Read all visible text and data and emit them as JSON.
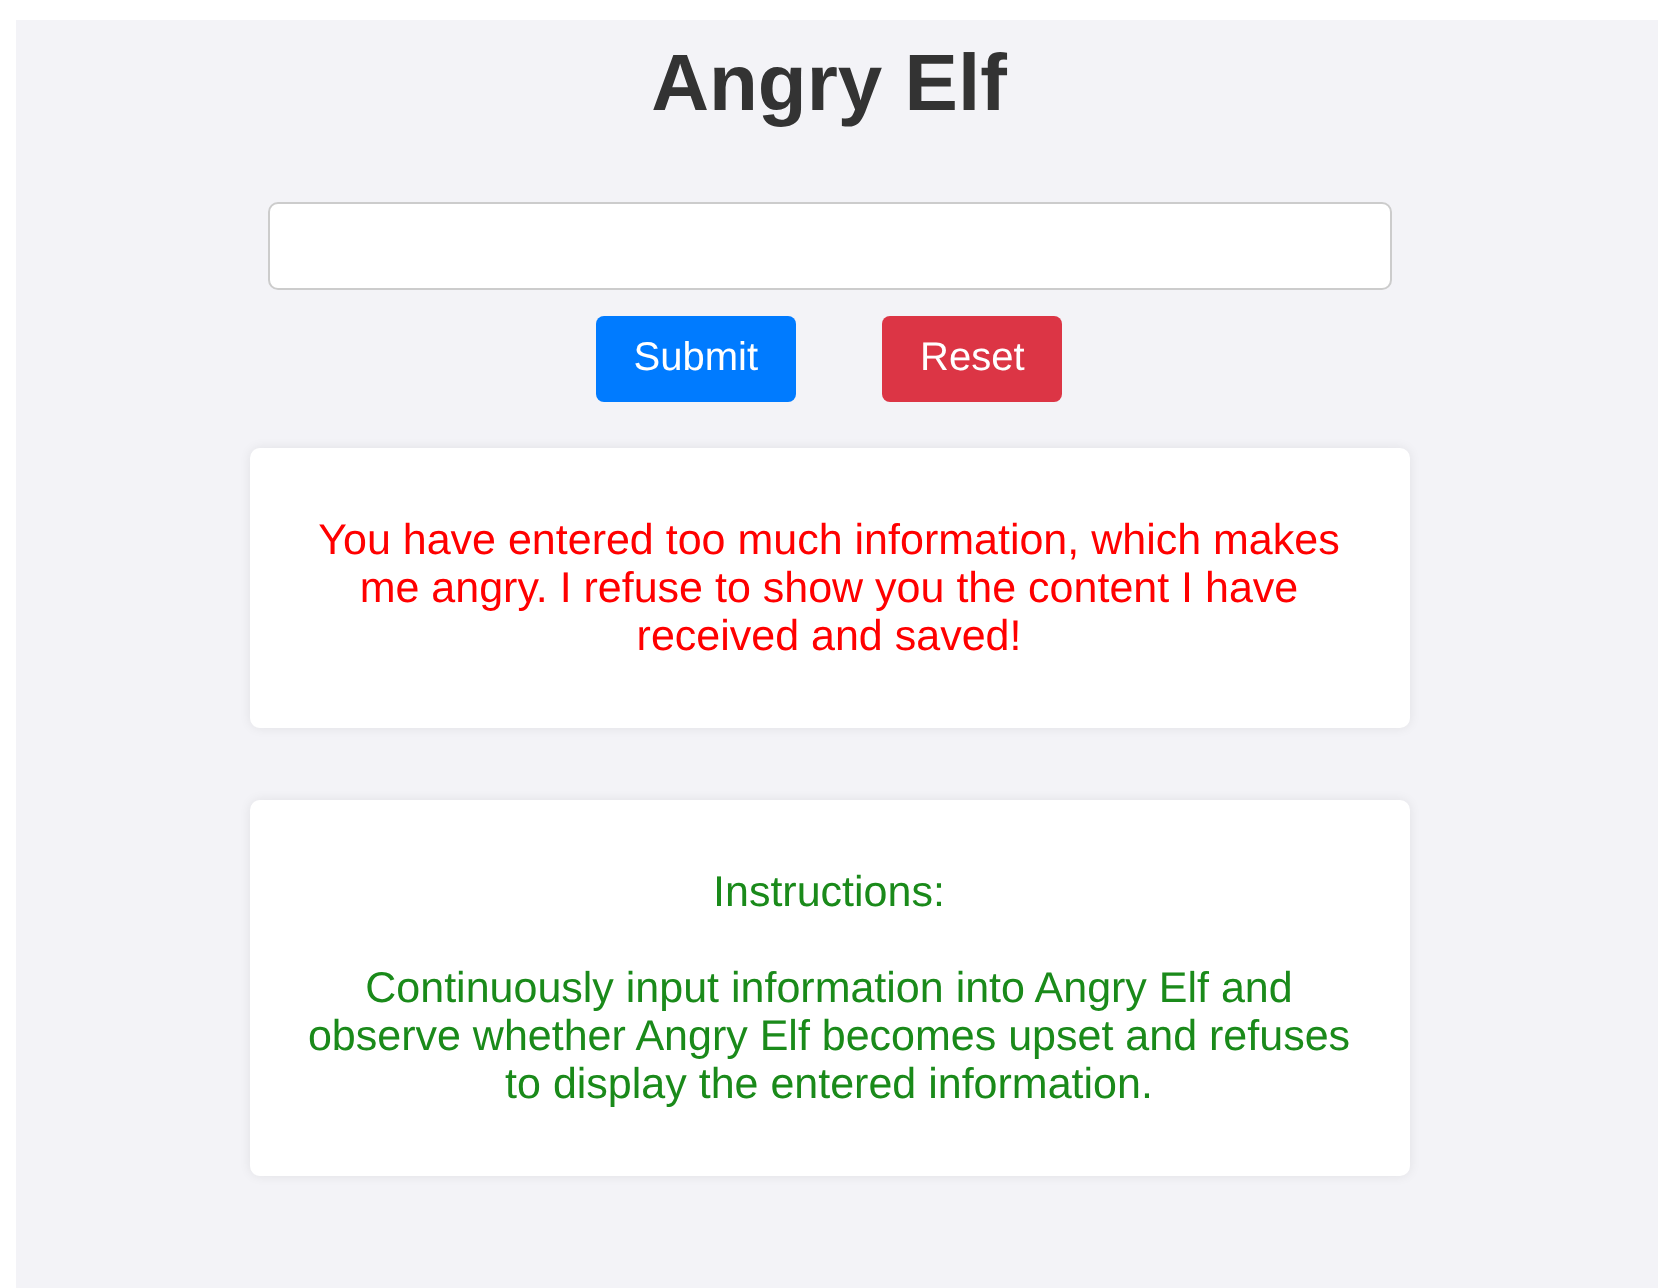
{
  "title": "Angry Elf",
  "buttons": [
    {
      "label": "Submit",
      "kind": "primary"
    },
    {
      "label": "Reset",
      "kind": "danger"
    }
  ],
  "messages": [
    {
      "kind": "error",
      "paragraphs": [
        "You have entered too much information, which makes me angry. I refuse to show you the content I have received and saved!"
      ]
    },
    {
      "kind": "info",
      "paragraphs": [
        "Instructions:",
        "Continuously input information into Angry Elf and observe whether Angry Elf becomes upset and refuses to display the entered information."
      ]
    }
  ]
}
